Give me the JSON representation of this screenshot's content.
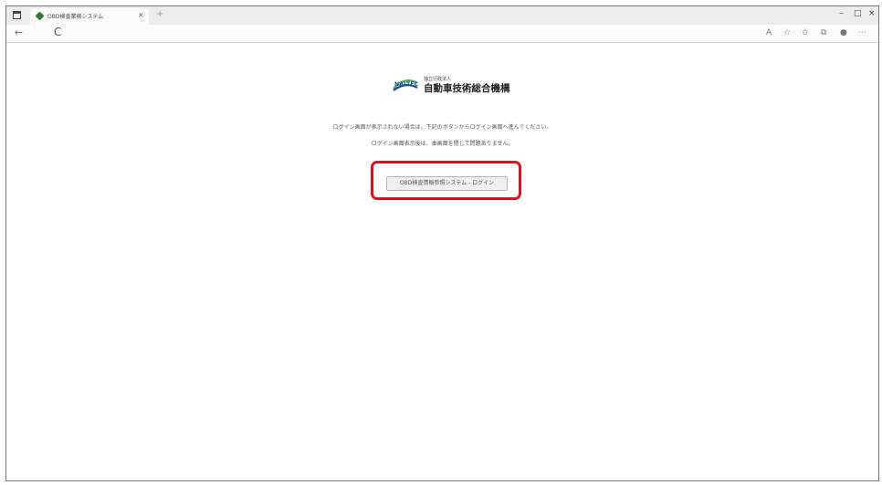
{
  "browser": {
    "tab_title": "OBD検査業務システム",
    "tab_close": "×",
    "new_tab": "+",
    "window_min": "–",
    "window_max": "□",
    "window_close": "×",
    "back": "←",
    "refresh": "C",
    "toolbar_icons": [
      "A",
      "☆",
      "✩",
      "⧉",
      "●",
      "···"
    ]
  },
  "page": {
    "logo": {
      "latin": "NALTEC",
      "small": "独立行政法人",
      "name": "自動車技術総合機構"
    },
    "message_line1": "ログイン画面が表示されない場合は、下記のボタンからログイン画面へ進んでください。",
    "message_line2": "ログイン画面表示後は、本画面を閉じて問題ありません。",
    "login_button": "OBD検査情報参照システム - ログイン"
  },
  "colors": {
    "highlight": "#e0101a",
    "logo_blue": "#1a4d8f",
    "logo_green": "#4caf50"
  }
}
